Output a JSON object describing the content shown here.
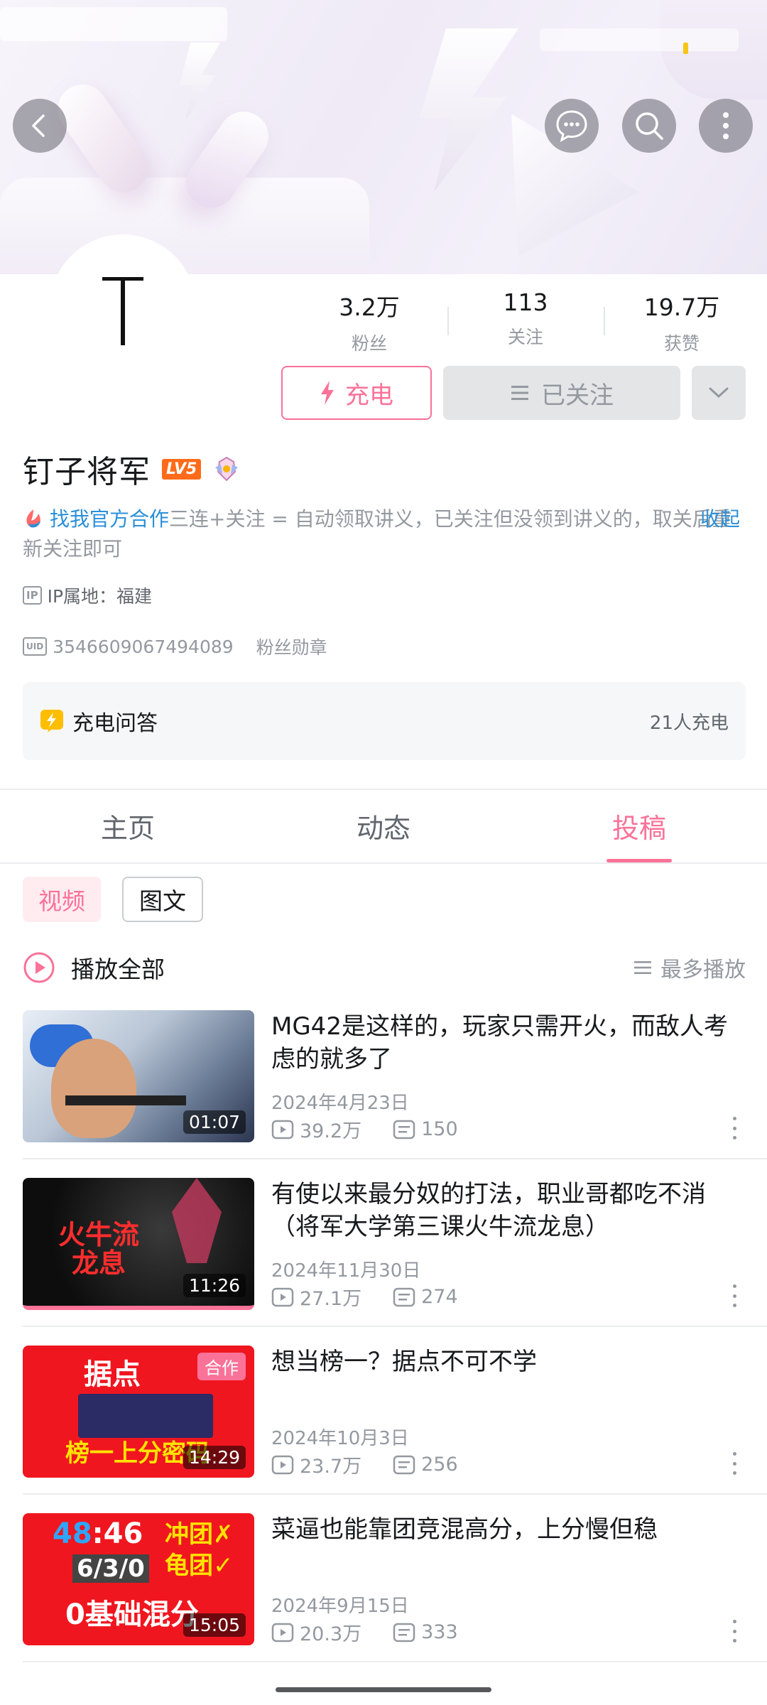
{
  "header": {
    "back_icon": "chevron-left-icon",
    "message_icon": "chat-bubble-icon",
    "search_icon": "search-icon",
    "more_icon": "more-vertical-icon"
  },
  "profile": {
    "stats": [
      {
        "value": "3.2万",
        "label": "粉丝"
      },
      {
        "value": "113",
        "label": "关注"
      },
      {
        "value": "19.7万",
        "label": "获赞"
      }
    ],
    "charge_label": "充电",
    "follow_label": "已关注",
    "name": "钉子将军",
    "level_badge": "LV5",
    "sign_highlight": "找我官方合作",
    "sign_text": "三连+关注 = 自动领取讲义，已关注但没领到讲义的，取关后重新关注即可",
    "collapse_label": "收起",
    "ip_location": "IP属地：福建",
    "uid": "3546609067494089",
    "fan_medal_label": "粉丝勋章",
    "charge_qa": {
      "title": "充电问答",
      "count": "21人充电"
    }
  },
  "tabs": [
    {
      "label": "主页",
      "active": false
    },
    {
      "label": "动态",
      "active": false
    },
    {
      "label": "投稿",
      "active": true
    }
  ],
  "filters": [
    "视频",
    "图文"
  ],
  "playall": {
    "label": "播放全部",
    "sort_label": "最多播放"
  },
  "videos": [
    {
      "title": "MG42是这样的，玩家只需开火，而敌人考虑的就多了",
      "date": "2024年4月23日",
      "views": "39.2万",
      "comments": "150",
      "duration": "01:07"
    },
    {
      "title": "有使以来最分奴的打法，职业哥都吃不消（将军大学第三课火牛流龙息）",
      "date": "2024年11月30日",
      "views": "27.1万",
      "comments": "274",
      "duration": "11:26",
      "thumb_text": "火牛流\n龙息"
    },
    {
      "title": "想当榜一？据点不可不学",
      "date": "2024年10月3日",
      "views": "23.7万",
      "comments": "256",
      "duration": "14:29",
      "badge": "合作",
      "thumb_text_top": "据点",
      "thumb_text_bottom": "榜一上分密码"
    },
    {
      "title": "菜逼也能靠团竞混高分，上分慢但稳",
      "date": "2024年9月15日",
      "views": "20.3万",
      "comments": "333",
      "duration": "15:05",
      "thumb_score_a": "48",
      "thumb_score_b": "46",
      "thumb_kda": "6/3/0",
      "thumb_line1": "冲团✗",
      "thumb_line2": "龟团✓",
      "thumb_bottom": "0基础混分"
    }
  ],
  "colors": {
    "accent": "#fb7299",
    "link": "#2a8fd8",
    "muted": "#9499a0"
  }
}
